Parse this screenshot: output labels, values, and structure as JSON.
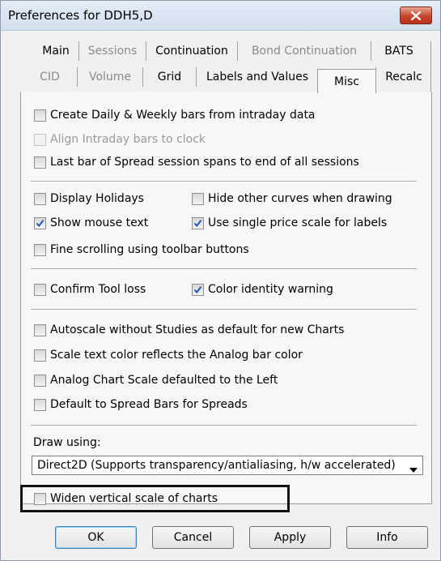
{
  "window": {
    "title": "Preferences for DDH5,D"
  },
  "tabs_row1": [
    {
      "label": "Main",
      "disabled": false
    },
    {
      "label": "Sessions",
      "disabled": true
    },
    {
      "label": "Continuation",
      "disabled": false
    },
    {
      "label": "Bond Continuation",
      "disabled": true
    },
    {
      "label": "BATS",
      "disabled": false
    }
  ],
  "tabs_row2": [
    {
      "label": "CID",
      "disabled": true
    },
    {
      "label": "Volume",
      "disabled": true
    },
    {
      "label": "Grid",
      "disabled": false
    },
    {
      "label": "Labels and Values",
      "disabled": false
    },
    {
      "label": "Misc",
      "active": true
    },
    {
      "label": "Recalc",
      "disabled": false
    }
  ],
  "options": {
    "create_daily_weekly": {
      "label": "Create Daily & Weekly bars from intraday data",
      "checked": false
    },
    "align_intraday": {
      "label": "Align Intraday bars to clock",
      "checked": false,
      "disabled": true
    },
    "last_bar_spread": {
      "label": "Last bar of Spread session spans to end of all sessions",
      "checked": false
    },
    "display_holidays": {
      "label": "Display Holidays",
      "checked": false
    },
    "hide_other_curves": {
      "label": "Hide other curves when drawing",
      "checked": false
    },
    "show_mouse_text": {
      "label": "Show mouse text",
      "checked": true
    },
    "single_price_scale": {
      "label": "Use single price scale for labels",
      "checked": true
    },
    "fine_scrolling": {
      "label": "Fine scrolling using toolbar buttons",
      "checked": false
    },
    "confirm_tool_loss": {
      "label": "Confirm Tool loss",
      "checked": false
    },
    "color_identity_warning": {
      "label": "Color identity warning",
      "checked": true
    },
    "autoscale_without_studies": {
      "label": "Autoscale without Studies as default for new Charts",
      "checked": false
    },
    "scale_text_color": {
      "label": "Scale text color reflects the Analog bar color",
      "checked": false
    },
    "analog_scale_left": {
      "label": "Analog Chart Scale defaulted to the Left",
      "checked": false
    },
    "default_spread_bars": {
      "label": "Default to Spread Bars for Spreads",
      "checked": false
    },
    "widen_vertical_scale": {
      "label": "Widen vertical scale of charts",
      "checked": false
    }
  },
  "draw_using": {
    "label": "Draw using:",
    "value": "Direct2D (Supports transparency/antialiasing, h/w accelerated)"
  },
  "buttons": {
    "ok": "OK",
    "cancel": "Cancel",
    "apply": "Apply",
    "info": "Info"
  },
  "colors": {
    "accent": "#3c7fb1",
    "close": "#c7452c"
  }
}
